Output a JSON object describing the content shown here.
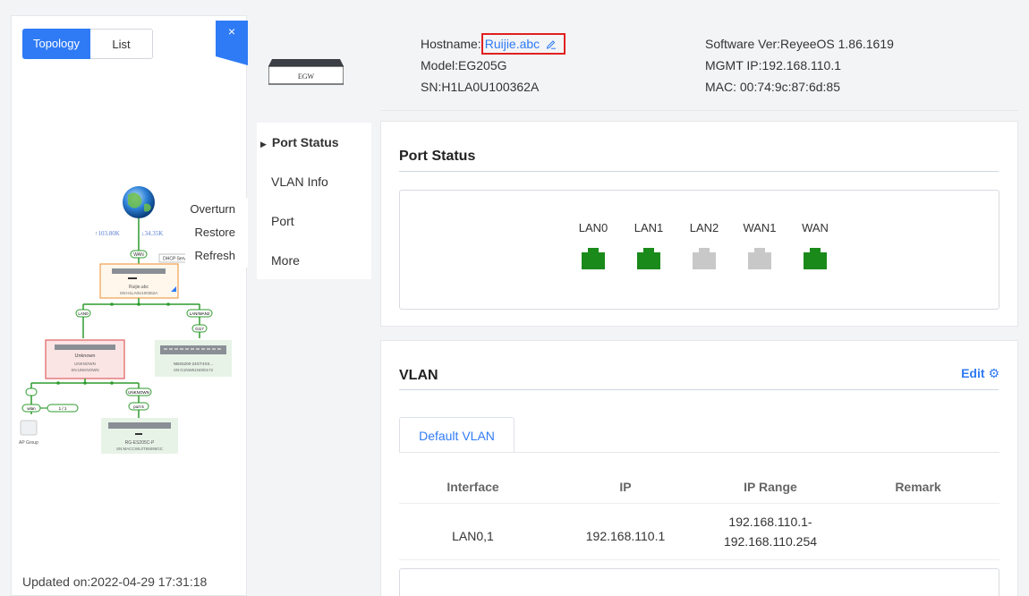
{
  "sidebar": {
    "topology_tab": "Topology",
    "list_tab": "List",
    "close_label": "×",
    "updated": "Updated on:2022-04-29 17:31:18",
    "context_menu": [
      "Overturn",
      "Restore",
      "Refresh"
    ]
  },
  "device": {
    "image_label": "EGW",
    "hostname_label": "Hostname:",
    "hostname_value": "Ruijie.abc",
    "model": "Model:EG205G",
    "sn": "SN:H1LA0U100362A",
    "software": "Software Ver:ReyeeOS 1.86.1619",
    "mgmt_ip": "MGMT IP:192.168.110.1",
    "mac": "MAC: 00:74:9c:87:6d:85"
  },
  "submenu": {
    "items": [
      "Port Status",
      "VLAN Info",
      "Port",
      "More"
    ],
    "active": "Port Status"
  },
  "port_status": {
    "title": "Port Status",
    "ports": [
      {
        "label": "LAN0",
        "status": "up"
      },
      {
        "label": "LAN1",
        "status": "up"
      },
      {
        "label": "LAN2",
        "status": "down"
      },
      {
        "label": "WAN1",
        "status": "down"
      },
      {
        "label": "WAN",
        "status": "up"
      }
    ]
  },
  "vlan": {
    "title": "VLAN",
    "edit_label": "Edit",
    "tab": "Default VLAN",
    "columns": [
      "Interface",
      "IP",
      "IP Range",
      "Remark"
    ],
    "rows": [
      {
        "interface": "LAN0,1",
        "ip": "192.168.110.1",
        "ip_range_start": "192.168.110.1-",
        "ip_range_end": "192.168.110.254",
        "remark": ""
      }
    ]
  },
  "topology": {
    "internet_up": "↑103.80K",
    "internet_down": "↓34.35K",
    "wan_tag": "WAN",
    "dhcp_tag": "DHCP Serv",
    "gateway_name": "Ruijie.abc",
    "gateway_sn": "SN:H1LA0U100362A",
    "lan_tag": "LAN0",
    "lanwan_tag": "LAN/WAN2",
    "sw_port_tag": "Gi17",
    "unknown_title": "Unknown",
    "unknown_name": "UNKNOWN",
    "unknown_sn": "SN:UNKNOWN",
    "nbs_name": "NBS5200-24GT4XS...",
    "nbs_sn": "SN:G1NW51N000172",
    "unknown2_tag": "UNKNOWN",
    "port5_tag": "port 5",
    "wlan_tag": "wlan",
    "ap_count": "1 / 1",
    "ap_group": "AP Group",
    "es_name": "RG-ES205C-P",
    "es_sn": "SN:MACCWL0T65095GC"
  },
  "colors": {
    "accent": "#2f7bf5",
    "port_up": "#1a8a1a",
    "port_down": "#c8c8c8",
    "highlight": "#e02020"
  }
}
